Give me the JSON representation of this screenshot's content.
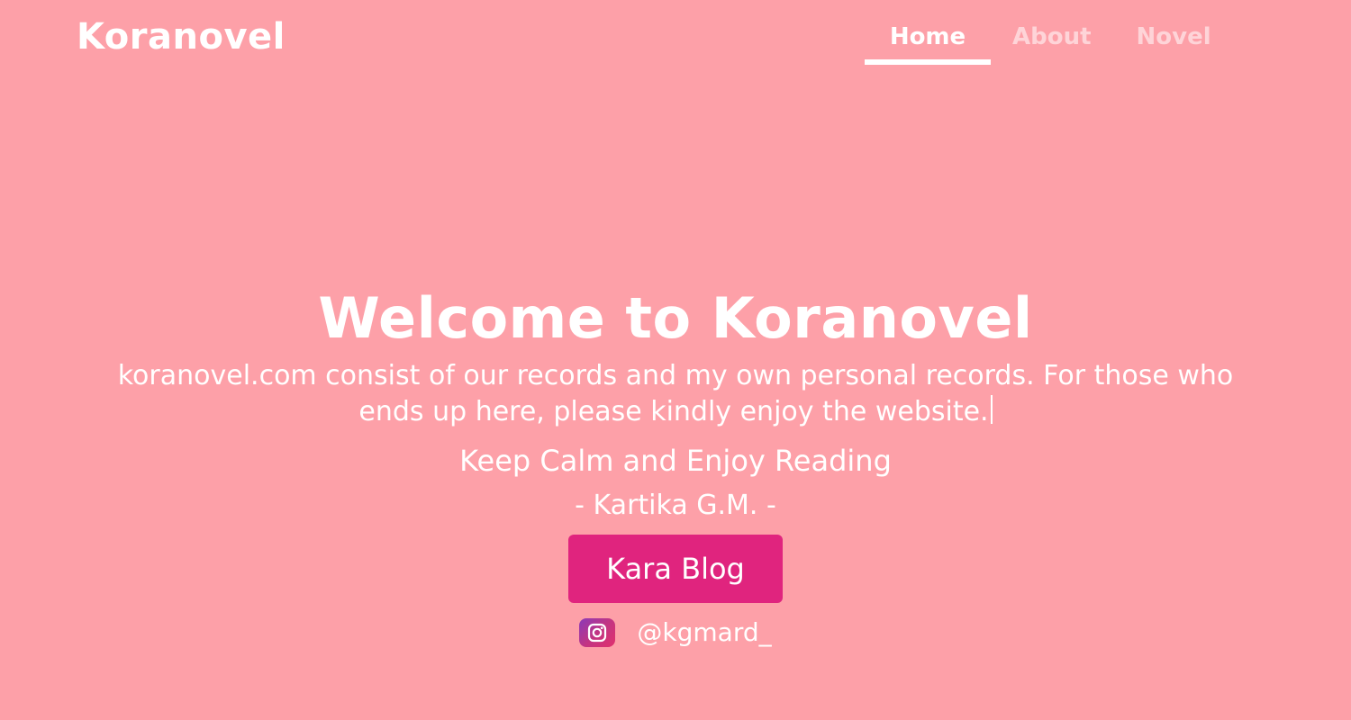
{
  "brand": {
    "name": "Koranovel"
  },
  "nav": {
    "items": [
      {
        "label": "Home",
        "active": true
      },
      {
        "label": "About",
        "active": false
      },
      {
        "label": "Novel",
        "active": false
      }
    ]
  },
  "hero": {
    "title": "Welcome to Koranovel",
    "description": "koranovel.com consist of our records and my own personal records. For those who ends up here, please kindly enjoy the website.",
    "quote": "Keep Calm and Enjoy Reading",
    "author": "- Kartika G.M. -",
    "cta_label": "Kara Blog"
  },
  "social": {
    "icon": "instagram-icon",
    "handle": "@kgmard_"
  },
  "colors": {
    "background": "#fda0a8",
    "cta": "#e0247e",
    "text": "#ffffff"
  }
}
